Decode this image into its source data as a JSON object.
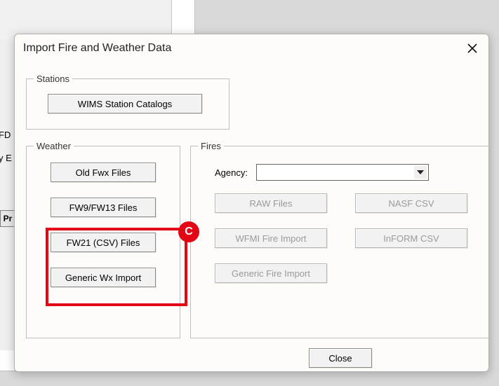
{
  "background": {
    "label1": "FD",
    "label2": "y E",
    "button": "Pr"
  },
  "dialog": {
    "title": "Import Fire and Weather Data",
    "close_label": "Close"
  },
  "stations": {
    "legend": "Stations",
    "wims_button": "WIMS Station Catalogs"
  },
  "weather": {
    "legend": "Weather",
    "old_fwx": "Old Fwx Files",
    "fw9_fw13": "FW9/FW13 Files",
    "fw21_csv": "FW21 (CSV) Files",
    "generic_wx": "Generic Wx Import"
  },
  "fires": {
    "legend": "Fires",
    "agency_label": "Agency:",
    "agency_value": "",
    "raw_files": "RAW Files",
    "nasf_csv": "NASF CSV",
    "wfmi": "WFMI Fire Import",
    "inform_csv": "InFORM CSV",
    "generic_fire": "Generic Fire Import"
  },
  "footer": {
    "close": "Close"
  },
  "annotation": {
    "marker": "C"
  }
}
